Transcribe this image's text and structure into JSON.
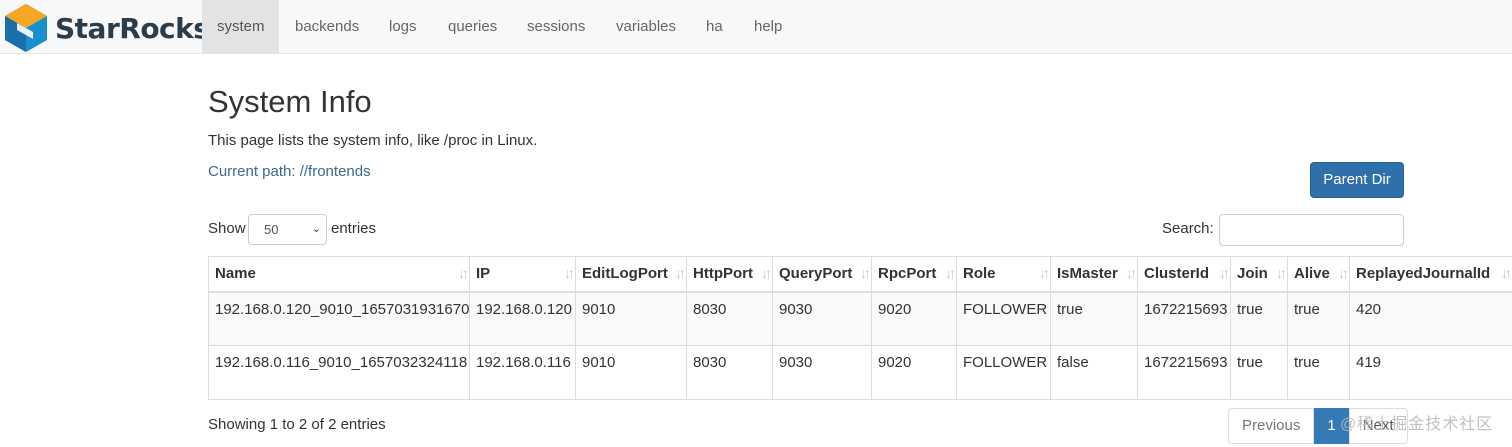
{
  "brand": {
    "name": "StarRocks"
  },
  "nav": {
    "items": [
      {
        "label": "system",
        "active": true
      },
      {
        "label": "backends"
      },
      {
        "label": "logs"
      },
      {
        "label": "queries"
      },
      {
        "label": "sessions"
      },
      {
        "label": "variables"
      },
      {
        "label": "ha"
      },
      {
        "label": "help"
      }
    ]
  },
  "page": {
    "title": "System Info",
    "description": "This page lists the system info, like /proc in Linux.",
    "current_path": "Current path: //frontends",
    "parent_dir_label": "Parent Dir"
  },
  "controls": {
    "show_label": "Show",
    "page_length": "50",
    "entries_label": "entries",
    "search_label": "Search:",
    "search_value": ""
  },
  "table": {
    "columns": [
      "Name",
      "IP",
      "EditLogPort",
      "HttpPort",
      "QueryPort",
      "RpcPort",
      "Role",
      "IsMaster",
      "ClusterId",
      "Join",
      "Alive",
      "ReplayedJournalId"
    ],
    "rows": [
      [
        "192.168.0.120_9010_1657031931670",
        "192.168.0.120",
        "9010",
        "8030",
        "9030",
        "9020",
        "FOLLOWER",
        "true",
        "1672215693",
        "true",
        "true",
        "420"
      ],
      [
        "192.168.0.116_9010_1657032324118",
        "192.168.0.116",
        "9010",
        "8030",
        "9030",
        "9020",
        "FOLLOWER",
        "false",
        "1672215693",
        "true",
        "true",
        "419"
      ]
    ]
  },
  "footer": {
    "info": "Showing 1 to 2 of 2 entries",
    "previous_label": "Previous",
    "current_page": "1",
    "next_label": "Next",
    "watermark": "@稀土掘金技术社区"
  },
  "colors": {
    "primary": "#337ab7",
    "link": "#3a6a8e",
    "brand_text": "#2a3d4c"
  }
}
